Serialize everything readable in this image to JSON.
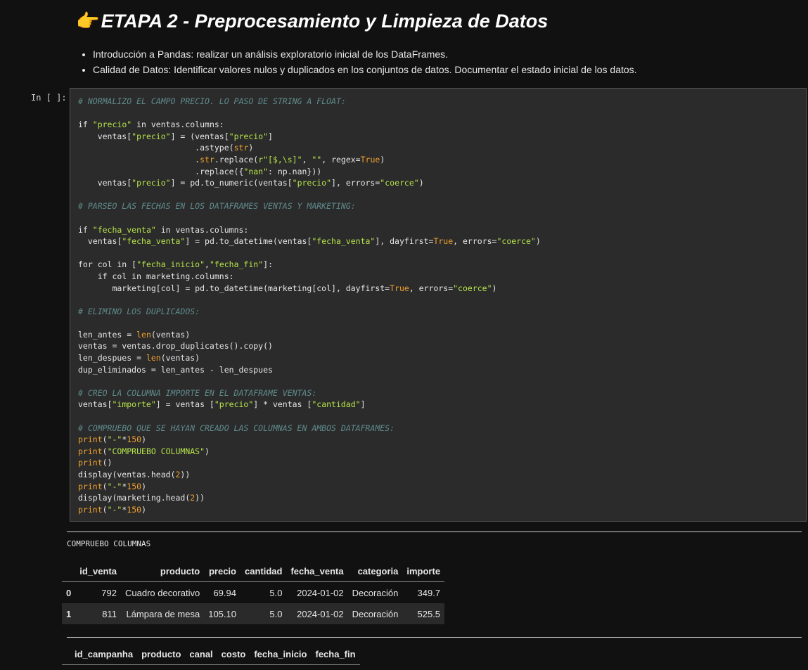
{
  "markdown": {
    "emoji": "👉",
    "title": "ETAPA 2 - Preprocesamiento y Limpieza de Datos",
    "bullets": [
      "Introducción a Pandas: realizar un análisis exploratorio inicial de los DataFrames.",
      "Calidad de Datos: Identificar valores nulos y duplicados en los conjuntos de datos. Documentar el estado inicial de los datos."
    ]
  },
  "cell": {
    "prompt": "In [ ]:",
    "code_lines": [
      "# NORMALIZO EL CAMPO PRECIO. LO PASO DE STRING A FLOAT:",
      "",
      "if \"precio\" in ventas.columns:",
      "    ventas[\"precio\"] = (ventas[\"precio\"]",
      "                        .astype(str)",
      "                        .str.replace(r\"[$,\\s]\", \"\", regex=True)",
      "                        .replace({\"nan\": np.nan}))",
      "    ventas[\"precio\"] = pd.to_numeric(ventas[\"precio\"], errors=\"coerce\")",
      "",
      "# PARSEO LAS FECHAS EN LOS DATAFRAMES VENTAS Y MARKETING:",
      "",
      "if \"fecha_venta\" in ventas.columns:",
      "  ventas[\"fecha_venta\"] = pd.to_datetime(ventas[\"fecha_venta\"], dayfirst=True, errors=\"coerce\")",
      "",
      "for col in [\"fecha_inicio\",\"fecha_fin\"]:",
      "    if col in marketing.columns:",
      "       marketing[col] = pd.to_datetime(marketing[col], dayfirst=True, errors=\"coerce\")",
      "",
      "# ELIMINO LOS DUPLICADOS:",
      "",
      "len_antes = len(ventas)",
      "ventas = ventas.drop_duplicates().copy()",
      "len_despues = len(ventas)",
      "dup_eliminados = len_antes - len_despues",
      "",
      "# CREO LA COLUMNA IMPORTE EN EL DATAFRAME VENTAS:",
      "ventas[\"importe\"] = ventas [\"precio\"] * ventas [\"cantidad\"]",
      "",
      "# COMPRUEBO QUE SE HAYAN CREADO LAS COLUMNAS EN AMBOS DATAFRAMES:",
      "print(\"-\"*150)",
      "print(\"COMPRUEBO COLUMNAS\")",
      "print()",
      "display(ventas.head(2))",
      "print(\"-\"*150)",
      "display(marketing.head(2))",
      "print(\"-\"*150)"
    ]
  },
  "output": {
    "stdout": "COMPRUEBO COLUMNAS",
    "ventas_table": {
      "headers": [
        "",
        "id_venta",
        "producto",
        "precio",
        "cantidad",
        "fecha_venta",
        "categoria",
        "importe"
      ],
      "rows": [
        [
          "0",
          "792",
          "Cuadro decorativo",
          "69.94",
          "5.0",
          "2024-01-02",
          "Decoración",
          "349.7"
        ],
        [
          "1",
          "811",
          "Lámpara de mesa",
          "105.10",
          "5.0",
          "2024-01-02",
          "Decoración",
          "525.5"
        ]
      ]
    },
    "marketing_table": {
      "headers": [
        "",
        "id_campanha",
        "producto",
        "canal",
        "costo",
        "fecha_inicio",
        "fecha_fin"
      ]
    }
  },
  "colors": {
    "background": "#111111",
    "cell_bg": "#2b2b2b",
    "comment": "#5f8a8b",
    "string": "#b6e34b",
    "number_builtin": "#f0a030"
  }
}
